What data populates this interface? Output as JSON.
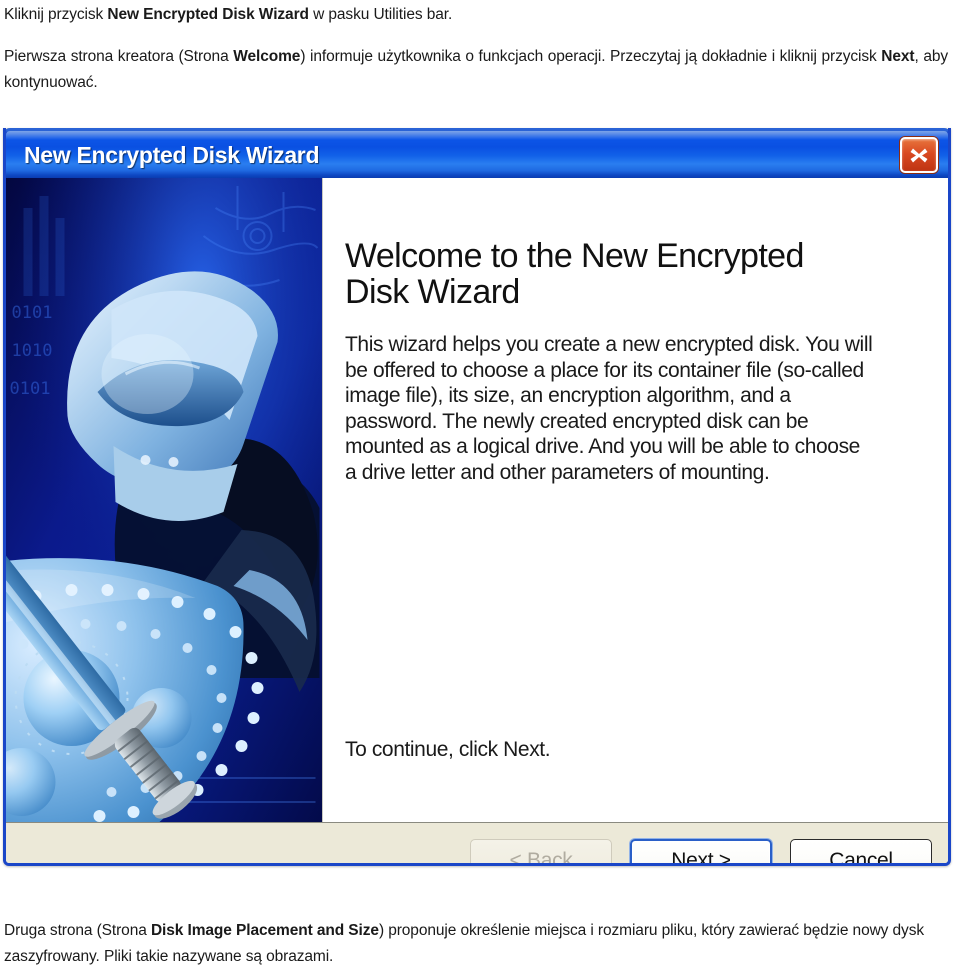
{
  "document": {
    "paragraph_top_1_prefix": "Kliknij przycisk ",
    "paragraph_top_1_bold": "New Encrypted Disk Wizard",
    "paragraph_top_1_suffix": " w pasku Utilities bar.",
    "paragraph_top_2_part1": "Pierwsza strona kreatora (Strona ",
    "paragraph_top_2_bold1": "Welcome",
    "paragraph_top_2_part2": ") informuje użytkownika o funkcjach operacji. Przeczytaj ją dokładnie i kliknij przycisk ",
    "paragraph_top_2_bold2": "Next",
    "paragraph_top_2_part3": ", aby kontynuować.",
    "paragraph_bottom_part1": "Druga strona (Strona ",
    "paragraph_bottom_bold": "Disk Image Placement and Size",
    "paragraph_bottom_part2": ") proponuje określenie miejsca i rozmiaru pliku, który zawierać będzie nowy dysk zaszyfrowany. Pliki takie nazywane są obrazami."
  },
  "dialog": {
    "title": "New Encrypted Disk Wizard",
    "close_icon": "close-icon",
    "heading": "Welcome to the New Encrypted\nDisk Wizard",
    "body": "This wizard helps you create a new encrypted disk. You will\nbe offered to choose a place for its container file (so-called\nimage file), its size, an encryption algorithm, and a\npassword. The newly created encrypted disk can be\nmounted as a logical drive. And you will be able to choose\na drive letter and other parameters of mounting.",
    "continue_text": "To continue, click Next.",
    "artwork_alt": "knight-helmet-shield-sword-illustration",
    "buttons": {
      "back": "< Back",
      "next": "Next >",
      "cancel": "Cancel"
    }
  },
  "colors": {
    "titlebar_blue": "#0a50e2",
    "dialog_border": "#1a46c8",
    "footer_beige": "#ece9d8",
    "close_red": "#d94a22",
    "default_button_focus": "#2a5fc8",
    "art_background": "#050a58"
  }
}
